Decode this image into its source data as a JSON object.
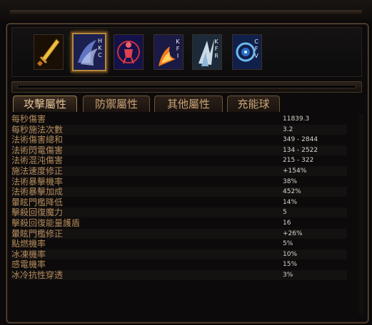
{
  "skill_gems": [
    {
      "name": "sword-skill-icon",
      "keys": [],
      "selected": false
    },
    {
      "name": "arcane-wings-skill-icon",
      "keys": [
        "H",
        "K",
        "C"
      ],
      "selected": true
    },
    {
      "name": "figure-aura-skill-icon",
      "keys": [],
      "selected": false
    },
    {
      "name": "fire-hand-skill-icon",
      "keys": [
        "K",
        "F",
        "I"
      ],
      "selected": false
    },
    {
      "name": "ice-shard-skill-icon",
      "keys": [
        "K",
        "F",
        "R"
      ],
      "selected": false
    },
    {
      "name": "vortex-skill-icon",
      "keys": [
        "C",
        "F",
        "V"
      ],
      "selected": false
    }
  ],
  "tabs": [
    {
      "label": "攻擊屬性",
      "active": true
    },
    {
      "label": "防禦屬性",
      "active": false
    },
    {
      "label": "其他屬性",
      "active": false
    },
    {
      "label": "充能球",
      "active": false
    }
  ],
  "stats": [
    {
      "label": "每秒傷害",
      "value": "11839.3"
    },
    {
      "label": "每秒施法次數",
      "value": "3.2"
    },
    {
      "label": "法術傷害總和",
      "value": "349 - 2844"
    },
    {
      "label": "法術閃電傷害",
      "value": "134 - 2522"
    },
    {
      "label": "法術混沌傷害",
      "value": "215 - 322"
    },
    {
      "label": "施法速度修正",
      "value": "+154%"
    },
    {
      "label": "法術暴擊機率",
      "value": "38%"
    },
    {
      "label": "法術暴擊加成",
      "value": "452%"
    },
    {
      "label": "暈眩門檻降低",
      "value": "14%"
    },
    {
      "label": "擊殺回復魔力",
      "value": "5"
    },
    {
      "label": "擊殺回復能量護盾",
      "value": "16"
    },
    {
      "label": "暈眩門檻修正",
      "value": "+26%"
    },
    {
      "label": "點燃機率",
      "value": "5%"
    },
    {
      "label": "冰凍機率",
      "value": "10%"
    },
    {
      "label": "感電機率",
      "value": "15%"
    },
    {
      "label": "冰冷抗性穿透",
      "value": "3%"
    }
  ]
}
